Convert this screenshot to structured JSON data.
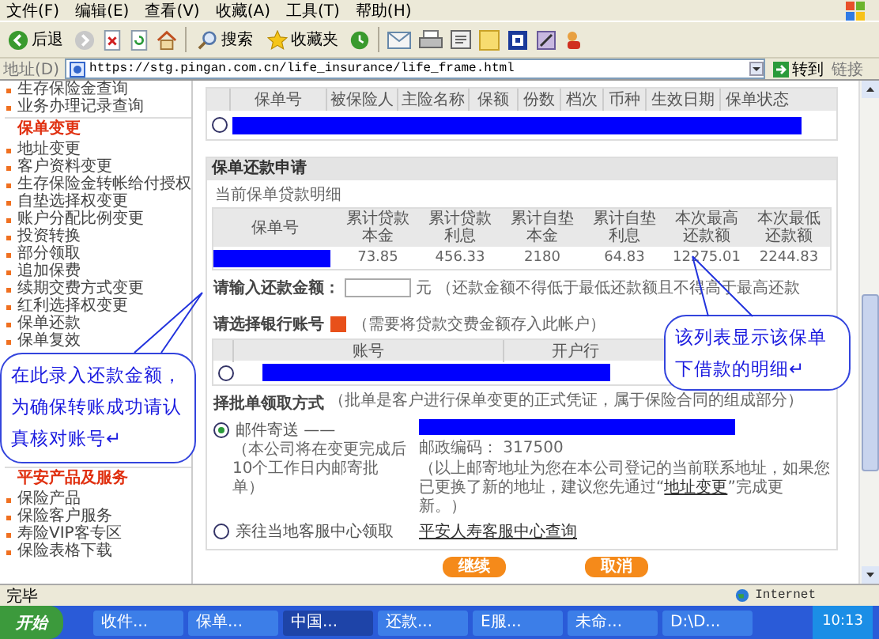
{
  "menu": [
    "文件(F)",
    "编辑(E)",
    "查看(V)",
    "收藏(A)",
    "工具(T)",
    "帮助(H)"
  ],
  "toolbar": {
    "back": "后退",
    "search": "搜索",
    "favorites": "收藏夹"
  },
  "address": {
    "label": "地址(D)",
    "url": "https://stg.pingan.com.cn/life_insurance/life_frame.html",
    "go": "转到",
    "links": "链接"
  },
  "sidebar": {
    "items_top": [
      "生存保险金查询",
      "业务办理记录查询"
    ],
    "sections": [
      {
        "title": "保单变更",
        "items": [
          "地址变更",
          "客户资料变更",
          "生存保险金转帐给付授权",
          "自垫选择权变更",
          "账户分配比例变更",
          "投资转换",
          "部分领取",
          "追加保费",
          "续期交费方式变更",
          "红利选择权变更",
          "保单还款",
          "保单复效"
        ]
      },
      {
        "title": "平安产品及服务",
        "items": [
          "保险产品",
          "保险客户服务",
          "寿险VIP客专区",
          "保险表格下载"
        ]
      }
    ]
  },
  "policy_table": {
    "columns": [
      "保单号",
      "被保险人",
      "主险名称",
      "保额",
      "份数",
      "档次",
      "币种",
      "生效日期",
      "保单状态"
    ],
    "rows": [
      {
        "selected": false
      }
    ]
  },
  "loan": {
    "title": "保单还款申请",
    "subtitle": "当前保单贷款明细",
    "columns": [
      "保单号",
      "累计贷款本金",
      "累计贷款利息",
      "累计自垫本金",
      "累计自垫利息",
      "本次最高还款额",
      "本次最低还款额"
    ],
    "values": [
      "73.85",
      "456.33",
      "2180",
      "64.83",
      "12275.01",
      "2244.83"
    ]
  },
  "amount": {
    "label": "请输入还款金额：",
    "unit": "元",
    "hint": "（还款金额不得低于最低还款额且不得高于最高还款"
  },
  "bank": {
    "title": "请选择银行账号",
    "hint": "（需要将贷款交费金额存入此帐户）",
    "columns": [
      "账号",
      "开户行"
    ],
    "rows": [
      {
        "selected": false
      }
    ]
  },
  "receipt": {
    "title": "择批单领取方式",
    "hint": "（批单是客户进行保单变更的正式凭证，属于保险合同的组成部分）",
    "options": [
      {
        "kind": "mail",
        "label": "邮件寄送 ——",
        "selected": true,
        "note": "（本公司将在变更完成后10个工作日内邮寄批单）",
        "postcode": "邮政编码： 317500",
        "before": "（以上邮寄地址为您在本公司登记的当前联系地址，如果您已更换了新的地址，建议您先通过“",
        "link": "地址变更",
        "after": "”完成更新。）"
      },
      {
        "kind": "pickup",
        "label": "亲往当地客服中心领取",
        "selected": false,
        "link": "平安人寿客服中心查询"
      }
    ]
  },
  "buttons": [
    "继续",
    "取消"
  ],
  "callouts": [
    {
      "text": "在此录入还款金额，为确保转账成功请认真核对账号↵"
    },
    {
      "text": "该列表显示该保单下借款的明细↵"
    }
  ],
  "status": {
    "text": "完毕",
    "zone": "Internet"
  },
  "taskbar": {
    "start": "开始",
    "tasks": [
      {
        "label": "收件...",
        "selected": false
      },
      {
        "label": "保单...",
        "selected": false
      },
      {
        "label": "中国...",
        "selected": true
      },
      {
        "label": "还款...",
        "selected": false
      },
      {
        "label": "E服...",
        "selected": false
      },
      {
        "label": "未命...",
        "selected": false
      },
      {
        "label": "D:\\D...",
        "selected": false
      }
    ],
    "clock": "10:13"
  }
}
